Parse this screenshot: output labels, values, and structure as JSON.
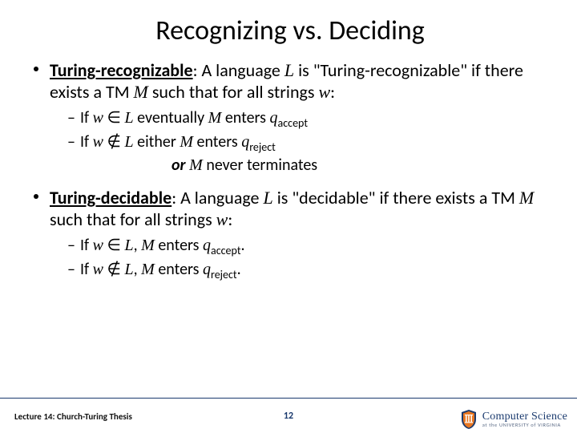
{
  "title": "Recognizing vs. Deciding",
  "b1": {
    "term": "Turing-recognizable",
    "rest_a": ": A language ",
    "L": "L",
    "rest_b": " is \"Turing-recognizable\" if there exists a TM ",
    "M": "M",
    "rest_c": " such that for all strings ",
    "w": "w",
    "rest_d": ":"
  },
  "s1a": {
    "pre": "If ",
    "w": "w",
    "in": " ∈ ",
    "L": "L",
    "mid": " eventually ",
    "M": "M",
    "post": " enters ",
    "q": "q",
    "sub": "accept"
  },
  "s1b": {
    "pre": "If ",
    "w": "w",
    "nin": " ∉ ",
    "L": "L",
    "mid": " either ",
    "M": "M",
    "post": " enters ",
    "q": "q",
    "sub": "reject"
  },
  "s1c": {
    "or": "or",
    "sp": " ",
    "M": "M",
    "rest": " never terminates"
  },
  "b2": {
    "term": "Turing-decidable",
    "rest_a": ": A language ",
    "L": "L",
    "rest_b": " is \"decidable\" if there exists a TM ",
    "M": "M",
    "rest_c": " such that for all strings ",
    "w": "w",
    "rest_d": ":"
  },
  "s2a": {
    "pre": "If ",
    "w": "w",
    "in": " ∈ ",
    "L": "L",
    "c": ", ",
    "M": "M",
    "post": " enters ",
    "q": "q",
    "sub": "accept",
    "dot": "."
  },
  "s2b": {
    "pre": "If ",
    "w": "w",
    "nin": " ∉ ",
    "L": "L",
    "c": ", ",
    "M": "M",
    "post": " enters ",
    "q": "q",
    "sub": "reject",
    "dot": "."
  },
  "footer": {
    "left": "Lecture 14: Church-Turing Thesis",
    "page": "12",
    "logo_line1": "Computer Science",
    "logo_line2": "at the UNIVERSITY of VIRGINIA"
  }
}
